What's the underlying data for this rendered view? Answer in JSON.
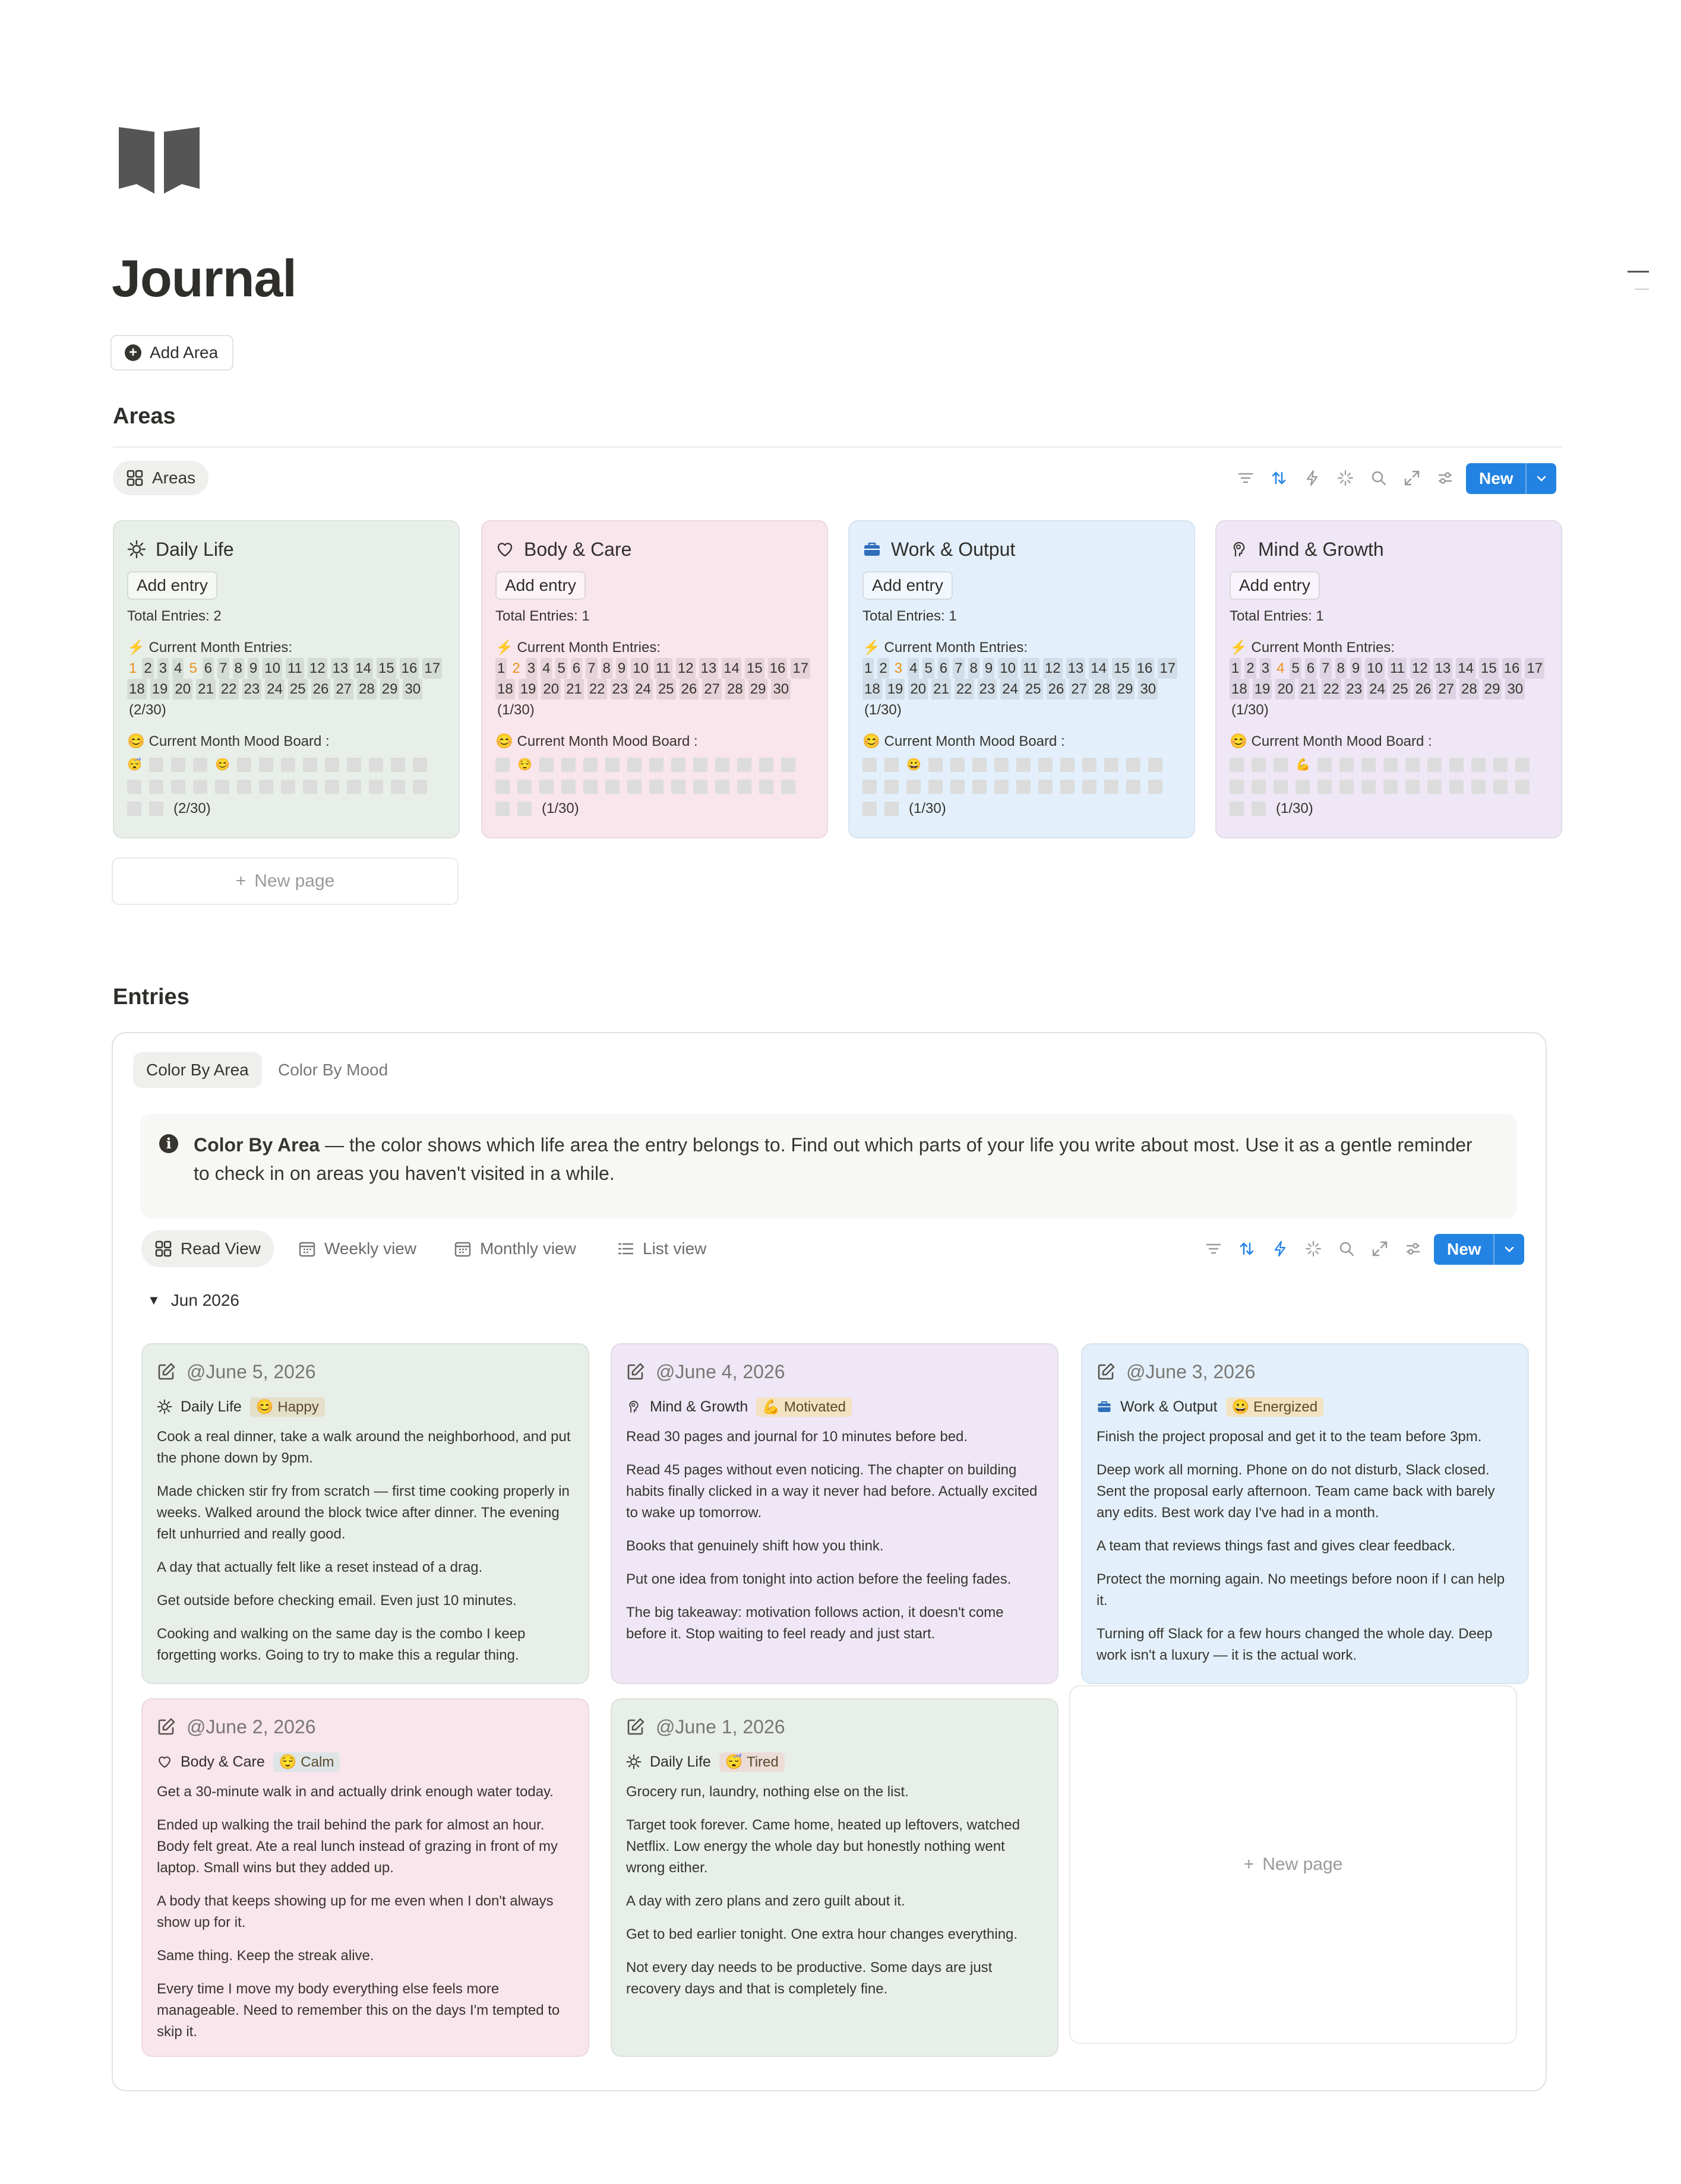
{
  "page": {
    "title": "Journal",
    "icon": "book-icon",
    "add_area_label": "Add Area"
  },
  "areas_section": {
    "heading": "Areas",
    "view_label": "Areas",
    "new_label": "New",
    "new_page_label": "New page",
    "cards": [
      {
        "name": "Daily Life",
        "icon": "sun-icon",
        "color": "#e8efe9",
        "add_entry": "Add entry",
        "total": "Total Entries: 2",
        "entries_label": "⚡ Current Month Entries:",
        "active_days": [
          1,
          5
        ],
        "entries_count": "(2/30)",
        "mood_label": "😊 Current Month Mood Board :",
        "moods": {
          "1": "😴",
          "5": "😊"
        },
        "mood_count": "(2/30)"
      },
      {
        "name": "Body & Care",
        "icon": "heart-icon",
        "color": "#f9e5ec",
        "add_entry": "Add entry",
        "total": "Total Entries: 1",
        "entries_label": "⚡ Current Month Entries:",
        "active_days": [
          2
        ],
        "entries_count": "(1/30)",
        "mood_label": "😊 Current Month Mood Board :",
        "moods": {
          "2": "😌"
        },
        "mood_count": "(1/30)"
      },
      {
        "name": "Work & Output",
        "icon": "briefcase-icon",
        "color": "#e3f0fb",
        "add_entry": "Add entry",
        "total": "Total Entries: 1",
        "entries_label": "⚡ Current Month Entries:",
        "active_days": [
          3
        ],
        "entries_count": "(1/30)",
        "mood_label": "😊 Current Month Mood Board :",
        "moods": {
          "3": "😀"
        },
        "mood_count": "(1/30)"
      },
      {
        "name": "Mind & Growth",
        "icon": "brain-icon",
        "color": "#efe7f6",
        "add_entry": "Add entry",
        "total": "Total Entries: 1",
        "entries_label": "⚡ Current Month Entries:",
        "active_days": [
          4
        ],
        "entries_count": "(1/30)",
        "mood_label": "😊 Current Month Mood Board :",
        "moods": {
          "4": "💪"
        },
        "mood_count": "(1/30)"
      }
    ]
  },
  "entries_section": {
    "heading": "Entries",
    "tabs": [
      "Color By Area",
      "Color By Mood"
    ],
    "info_bold": "Color By Area",
    "info_text": " — the color shows which life area the entry belongs to. Find out which parts of your life you write about most. Use it as a gentle reminder to check in on areas you haven't visited in a while.",
    "views": [
      "Read View",
      "Weekly view",
      "Monthly view",
      "List view"
    ],
    "new_label": "New",
    "group": "Jun 2026",
    "new_page_label": "New page",
    "entries": [
      {
        "date": "@June 5, 2026",
        "area": "Daily Life",
        "area_icon": "sun-icon",
        "mood": "😊 Happy",
        "color": "#e8efe9",
        "tag_color": "#e4dfc8",
        "paragraphs": [
          "Cook a real dinner, take a walk around the neighborhood, and put the phone down by 9pm.",
          "Made chicken stir fry from scratch — first time cooking properly in weeks. Walked around the block twice after dinner. The evening felt unhurried and really good.",
          "A day that actually felt like a reset instead of a drag.",
          "Get outside before checking email. Even just 10 minutes.",
          "Cooking and walking on the same day is the combo I keep forgetting works. Going to try to make this a regular thing."
        ]
      },
      {
        "date": "@June 4, 2026",
        "area": "Mind & Growth",
        "area_icon": "brain-icon",
        "mood": "💪 Motivated",
        "color": "#efe7f6",
        "tag_color": "#f3e3c2",
        "paragraphs": [
          "Read 30 pages and journal for 10 minutes before bed.",
          "Read 45 pages without even noticing. The chapter on building habits finally clicked in a way it never had before. Actually excited to wake up tomorrow.",
          "Books that genuinely shift how you think.",
          "Put one idea from tonight into action before the feeling fades.",
          "The big takeaway: motivation follows action, it doesn't come before it. Stop waiting to feel ready and just start."
        ]
      },
      {
        "date": "@June 3, 2026",
        "area": "Work & Output",
        "area_icon": "briefcase-icon",
        "mood": "😀 Energized",
        "color": "#e3f0fb",
        "tag_color": "#f3e3c2",
        "paragraphs": [
          "Finish the project proposal and get it to the team before 3pm.",
          "Deep work all morning. Phone on do not disturb, Slack closed. Sent the proposal early afternoon. Team came back with barely any edits. Best work day I've had in a month.",
          "A team that reviews things fast and gives clear feedback.",
          "Protect the morning again. No meetings before noon if I can help it.",
          "Turning off Slack for a few hours changed the whole day. Deep work isn't a luxury — it is the actual work."
        ]
      },
      {
        "date": "@June 2, 2026",
        "area": "Body & Care",
        "area_icon": "heart-icon",
        "mood": "😌 Calm",
        "color": "#f9e5ec",
        "tag_color": "#dfe5e6",
        "paragraphs": [
          "Get a 30-minute walk in and actually drink enough water today.",
          "Ended up walking the trail behind the park for almost an hour. Body felt great. Ate a real lunch instead of grazing in front of my laptop. Small wins but they added up.",
          "A body that keeps showing up for me even when I don't always show up for it.",
          "Same thing. Keep the streak alive.",
          "Every time I move my body everything else feels more manageable. Need to remember this on the days I'm tempted to skip it."
        ]
      },
      {
        "date": "@June 1, 2026",
        "area": "Daily Life",
        "area_icon": "sun-icon",
        "mood": "😴 Tired",
        "color": "#e8efe9",
        "tag_color": "#ecdcd7",
        "paragraphs": [
          "Grocery run, laundry, nothing else on the list.",
          "Target took forever. Came home, heated up leftovers, watched Netflix. Low energy the whole day but honestly nothing went wrong either.",
          "A day with zero plans and zero guilt about it.",
          "Get to bed earlier tonight. One extra hour changes everything.",
          "Not every day needs to be productive. Some days are just recovery days and that is completely fine."
        ]
      }
    ]
  }
}
